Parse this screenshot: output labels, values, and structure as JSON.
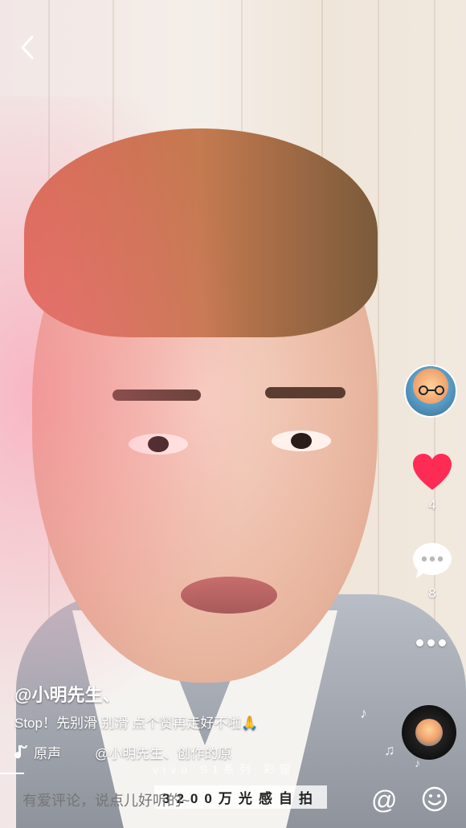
{
  "author": "@小明先生、",
  "description": "Stop！先别滑 别滑 点个赞再走好不啦🙏",
  "music": {
    "label": "原声",
    "creator": "@小明先生、创作的原"
  },
  "actions": {
    "like_count": "4",
    "comment_count": "8"
  },
  "watermark": {
    "line1": "vivo S1系列 彩窗",
    "line2": "3200万光感自拍"
  },
  "comment_bar": {
    "placeholder": "有爱评论，说点儿好听的~"
  },
  "colors": {
    "like": "#fe2c55",
    "text": "#ffffff"
  },
  "icons": [
    "back-arrow-icon",
    "avatar",
    "heart-icon",
    "comment-icon",
    "more-icon",
    "music-note-icon",
    "music-disc",
    "at-icon",
    "emoji-icon"
  ]
}
